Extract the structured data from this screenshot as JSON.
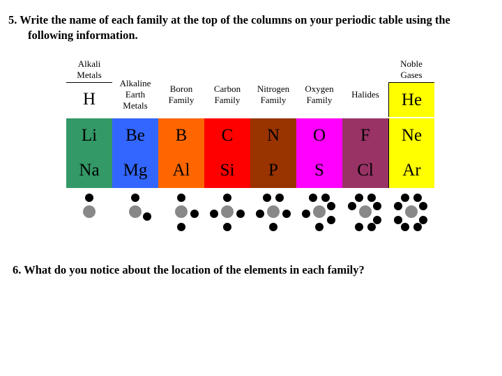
{
  "question5": {
    "line1": "5. Write the name of each family at the top of the columns on your periodic table using the",
    "line2": "following information."
  },
  "question6": "6. What do you notice about the location of the elements in each family?",
  "families": [
    {
      "label": "Alkali Metals",
      "color": "#339966",
      "elements": [
        "H",
        "Li",
        "Na"
      ],
      "valence": 1
    },
    {
      "label": "Alkaline Earth Metals",
      "color": "#3366ff",
      "elements": [
        "",
        "Be",
        "Mg"
      ],
      "valence": 2
    },
    {
      "label": "Boron Family",
      "color": "#ff6600",
      "elements": [
        "",
        "B",
        "Al"
      ],
      "valence": 3
    },
    {
      "label": "Carbon Family",
      "color": "#ff0000",
      "elements": [
        "",
        "C",
        "Si"
      ],
      "valence": 4
    },
    {
      "label": "Nitrogen Family",
      "color": "#993300",
      "elements": [
        "",
        "N",
        "P"
      ],
      "valence": 5
    },
    {
      "label": "Oxygen Family",
      "color": "#ff00ff",
      "elements": [
        "",
        "O",
        "S"
      ],
      "valence": 6
    },
    {
      "label": "Halides",
      "color": "#993366",
      "elements": [
        "",
        "F",
        "Cl"
      ],
      "valence": 7
    },
    {
      "label": "Noble Gases",
      "color": "#ffff00",
      "elements": [
        "He",
        "Ne",
        "Ar"
      ],
      "valence": 8
    }
  ]
}
